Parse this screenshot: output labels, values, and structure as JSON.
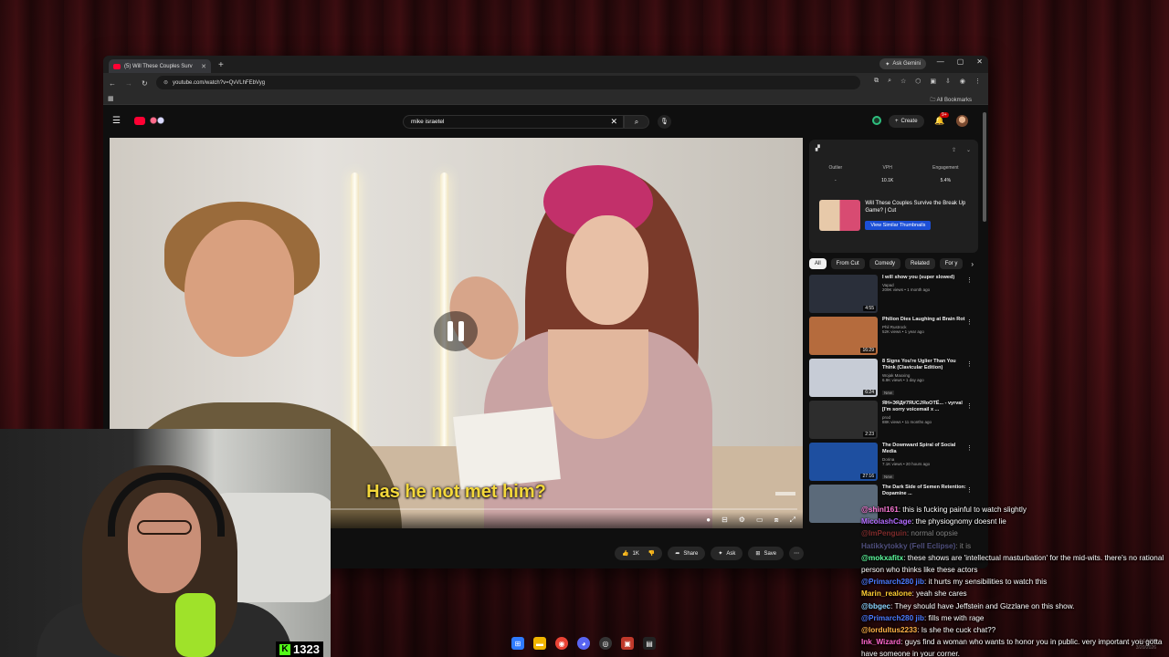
{
  "browser": {
    "tab_title": "(5) Will These Couples Surv",
    "url": "youtube.com/watch?v=QvVLhFEbVyg",
    "gemini_label": "Ask Gemini",
    "bookmarks_label": "All Bookmarks"
  },
  "youtube": {
    "search_value": "mike israetel",
    "create_label": "Create",
    "notification_count": "9+",
    "caption": "Has he not met him?",
    "actions": {
      "likes": "1K",
      "share": "Share",
      "ask": "Ask",
      "save": "Save"
    }
  },
  "extension_panel": {
    "stats": [
      {
        "label": "Outlier",
        "value": "-"
      },
      {
        "label": "VPH",
        "value": "10.1K"
      },
      {
        "label": "Engagement",
        "value": "5.4%"
      }
    ],
    "card_title": "Will These Couples Survive the Break Up Game? | Cut",
    "similar_button": "View Similar Thumbnails"
  },
  "chips": [
    "All",
    "From Cut",
    "Comedy",
    "Related",
    "For y"
  ],
  "recommendations": [
    {
      "title": "I will show you (super slowed)",
      "channel": "Vapad",
      "meta": "209K views • 1 month ago",
      "duration": "4:55",
      "new": "",
      "color": "#2a2f3a"
    },
    {
      "title": "Philion Dies Laughing at Brain Rot",
      "channel": "Phil Rustrock",
      "meta": "52K views • 1 year ago",
      "duration": "16:29",
      "new": "",
      "color": "#b56b3d"
    },
    {
      "title": "8 Signs You're Uglier Than You Think (Clavicular Edition)",
      "channel": "Wojak Maxxing",
      "meta": "6.9K views • 1 day ago",
      "duration": "6:24",
      "new": "New",
      "color": "#c7ccd6"
    },
    {
      "title": "ЯН+ЭЯД#7ЯUCJЯoOТЁ... - vyrval [I'm sorry voicemail x ...",
      "channel": "prod",
      "meta": "88K views • 11 months ago",
      "duration": "2:23",
      "new": "",
      "color": "#2d2d2d"
    },
    {
      "title": "The Downward Spiral of Social Media",
      "channel": "Dorina",
      "meta": "7.1K views • 20 hours ago",
      "duration": "27:16",
      "new": "New",
      "color": "#1e4fa0"
    },
    {
      "title": "The Dark Side of Semen Retention: Dopamine ...",
      "channel": "",
      "meta": "",
      "duration": "",
      "new": "",
      "color": "#5b6a7a"
    }
  ],
  "chat": [
    {
      "user": "@shinl161",
      "color": "#ff7ad9",
      "text": ": this is fucking painful to watch slightly"
    },
    {
      "user": "MicolashCage",
      "color": "#b36bff",
      "text": ": the physiognomy doesnt lie"
    },
    {
      "user": "@ImPenguin",
      "color": "#ff4b4b",
      "text": ": normal oopsie"
    },
    {
      "user": "Hatikkytokky (Fell Eclipse)",
      "color": "#9a9aff",
      "text": ": it is"
    },
    {
      "user": "@mokxafitx",
      "color": "#5dfc9e",
      "text": ": these shows are 'intellectual masturbation' for the mid-wits. there's no rational person who thinks like these actors"
    },
    {
      "user": "@Primarch280 jib",
      "color": "#4b7bff",
      "text": ": it hurts my sensibilities to watch this"
    },
    {
      "user": "Marin_realone",
      "color": "#ffcc33",
      "text": ": yeah she cares"
    },
    {
      "user": "@bbgec",
      "color": "#8ad4ff",
      "text": ": They should have Jeffstein and Gizzlane on this show."
    },
    {
      "user": "@Primarch280 jib",
      "color": "#4b7bff",
      "text": ": fills me with rage"
    },
    {
      "user": "@lordultus2233",
      "color": "#ffb347",
      "text": ": Is she the cuck chat??"
    },
    {
      "user": "Ink_Wizard",
      "color": "#ff66cc",
      "text": ": guys find a woman who wants to honor you in public. very important you gotta have someone in your corner."
    }
  ],
  "kick": {
    "viewers": "1323"
  },
  "tray": {
    "time": "6:14 PM",
    "date": "3/20/2026"
  }
}
